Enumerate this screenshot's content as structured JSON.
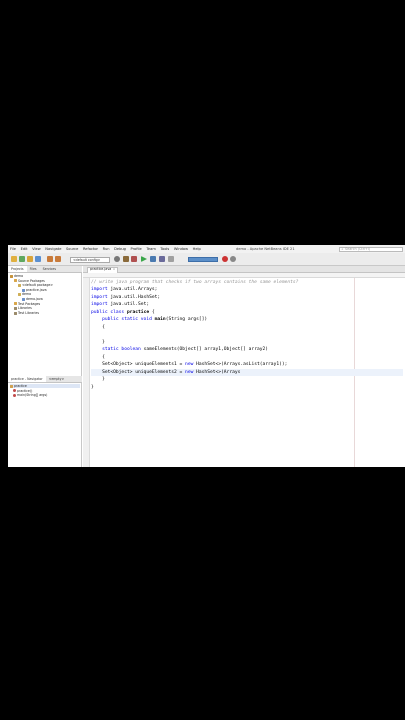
{
  "menu": [
    "File",
    "Edit",
    "View",
    "Navigate",
    "Source",
    "Refactor",
    "Run",
    "Debug",
    "Profile",
    "Team",
    "Tools",
    "Window",
    "Help"
  ],
  "window_title": "demo - Apache NetBeans IDE 21",
  "search_placeholder": "Search (Ctrl+I)",
  "toolbar": {
    "config_select": "<default config>"
  },
  "projects_panel": {
    "tabs": [
      "Projects",
      "Files",
      "Services"
    ],
    "tree": [
      {
        "label": "demo",
        "indent": 0
      },
      {
        "label": "Source Packages",
        "indent": 1
      },
      {
        "label": "<default package>",
        "indent": 2
      },
      {
        "label": "practice.java",
        "indent": 3
      },
      {
        "label": "demo",
        "indent": 2
      },
      {
        "label": "demo.java",
        "indent": 3
      },
      {
        "label": "Test Packages",
        "indent": 1
      },
      {
        "label": "Libraries",
        "indent": 1
      },
      {
        "label": "Test Libraries",
        "indent": 1
      }
    ]
  },
  "navigator_panel": {
    "tabs": [
      "practice - Navigator",
      "<empty>"
    ],
    "members": [
      {
        "label": "practice",
        "indent": 0
      },
      {
        "label": "practice()",
        "indent": 1
      },
      {
        "label": "main(String[] args)",
        "indent": 1
      }
    ]
  },
  "editor": {
    "file_tab": "practice.java",
    "lines": [
      {
        "kind": "comment",
        "text": "// write java program that checks if two arrays contains the same elements?"
      },
      {
        "kind": "import",
        "kw": "import",
        "rest": " java.util.Arrays;"
      },
      {
        "kind": "import",
        "kw": "import",
        "rest": " java.util.HashSet;"
      },
      {
        "kind": "import",
        "kw": "import",
        "rest": " java.util.Set;"
      },
      {
        "kind": "class",
        "kw": "public class",
        "name": " practice",
        "rest": " {"
      },
      {
        "kind": "main",
        "kw": "    public static void",
        "name": " main",
        "rest": "(String args[])"
      },
      {
        "kind": "plain",
        "text": "    {"
      },
      {
        "kind": "plain",
        "text": ""
      },
      {
        "kind": "plain",
        "text": "    }"
      },
      {
        "kind": "method",
        "kw": "    static boolean",
        "rest": " sameElements(Object[] array1,Object[] array2)"
      },
      {
        "kind": "plain",
        "text": "    {"
      },
      {
        "kind": "set1",
        "pre": "    Set<Object> uniqueElements1 = ",
        "kw": "new",
        "rest": " HashSet<>(Arrays.asList(array1));"
      },
      {
        "kind": "set2",
        "pre": "    Set<Object> uniqueElements2 = ",
        "kw": "new",
        "rest": " HashSet<>(Arrays"
      },
      {
        "kind": "plain",
        "text": "    }"
      },
      {
        "kind": "plain",
        "text": "}"
      }
    ]
  },
  "colors": {
    "keyword": "#0000e6",
    "comment": "#969696",
    "current_line": "#ecf2fb"
  }
}
